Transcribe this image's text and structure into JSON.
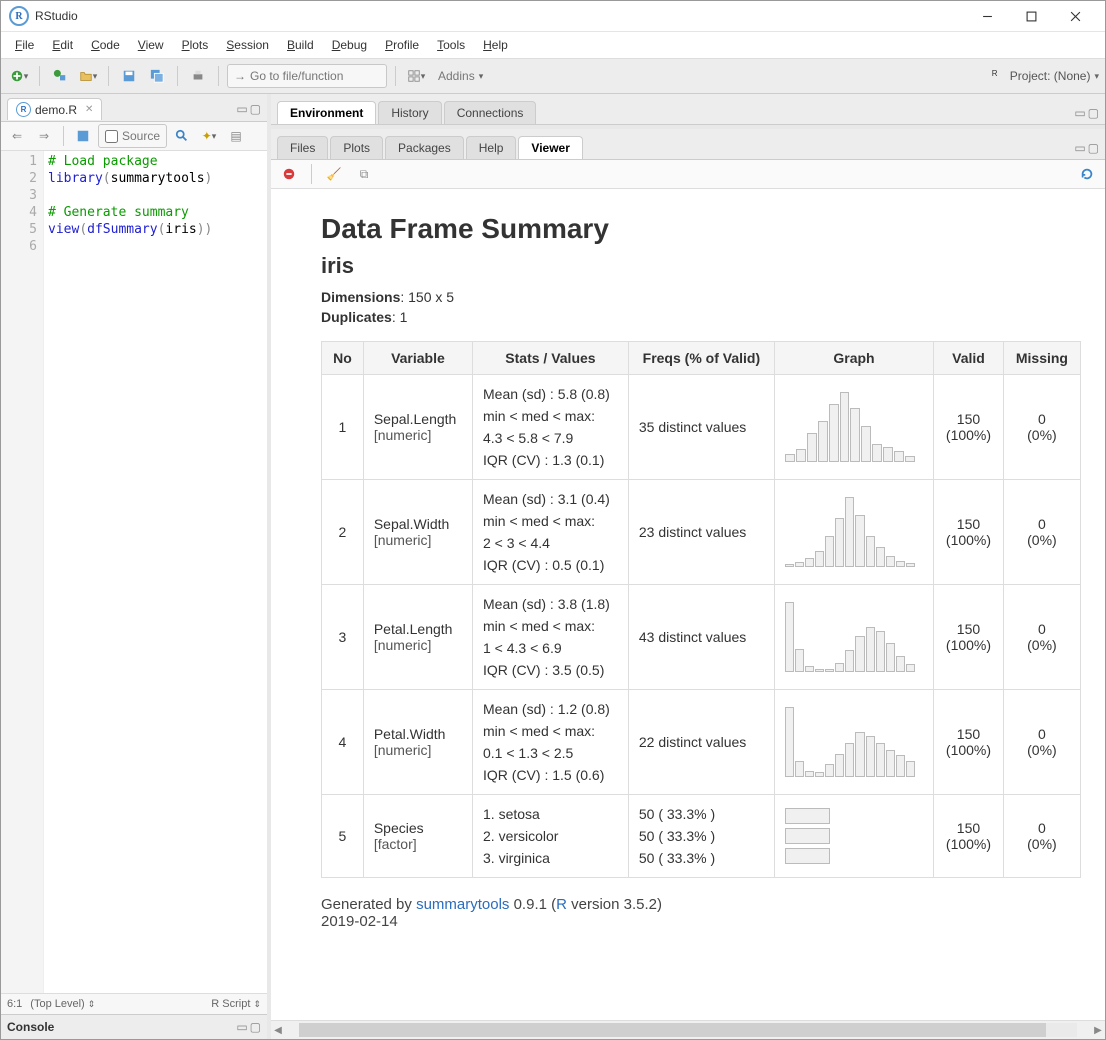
{
  "window": {
    "title": "RStudio",
    "project_label": "Project: (None)"
  },
  "menubar": [
    {
      "label": "File",
      "u": 0
    },
    {
      "label": "Edit",
      "u": 0
    },
    {
      "label": "Code",
      "u": 0
    },
    {
      "label": "View",
      "u": 0
    },
    {
      "label": "Plots",
      "u": 0
    },
    {
      "label": "Session",
      "u": 0
    },
    {
      "label": "Build",
      "u": 0
    },
    {
      "label": "Debug",
      "u": 0
    },
    {
      "label": "Profile",
      "u": 0
    },
    {
      "label": "Tools",
      "u": 0
    },
    {
      "label": "Help",
      "u": 0
    }
  ],
  "toolbar": {
    "goto_placeholder": "Go to file/function",
    "addins_label": "Addins"
  },
  "editor": {
    "filename": "demo.R",
    "source_btn": "Source",
    "gutter": [
      1,
      2,
      3,
      4,
      5,
      6
    ],
    "lines": [
      [
        {
          "t": "# Load package",
          "cls": "c-comment"
        }
      ],
      [
        {
          "t": "library",
          "cls": "c-func"
        },
        {
          "t": "(",
          "cls": "c-paren"
        },
        {
          "t": "summarytools",
          "cls": "c-ident"
        },
        {
          "t": ")",
          "cls": "c-paren"
        }
      ],
      [],
      [
        {
          "t": "# Generate summary",
          "cls": "c-comment"
        }
      ],
      [
        {
          "t": "view",
          "cls": "c-func"
        },
        {
          "t": "(",
          "cls": "c-paren"
        },
        {
          "t": "dfSummary",
          "cls": "c-func"
        },
        {
          "t": "(",
          "cls": "c-paren"
        },
        {
          "t": "iris",
          "cls": "c-ident"
        },
        {
          "t": "))",
          "cls": "c-paren"
        }
      ],
      []
    ],
    "status_pos": "6:1",
    "status_scope": "(Top Level)",
    "status_lang": "R Script"
  },
  "top_right_tabs": [
    "Environment",
    "History",
    "Connections"
  ],
  "bottom_right_tabs": [
    "Files",
    "Plots",
    "Packages",
    "Help",
    "Viewer"
  ],
  "console_label": "Console",
  "chart_data": {
    "type": "table",
    "title": "Data Frame Summary",
    "subtitle": "iris",
    "dimensions_label": "Dimensions",
    "dimensions": "150 x 5",
    "duplicates_label": "Duplicates",
    "duplicates": "1",
    "columns": [
      "No",
      "Variable",
      "Stats / Values",
      "Freqs (% of Valid)",
      "Graph",
      "Valid",
      "Missing"
    ],
    "rows": [
      {
        "no": 1,
        "variable": "Sepal.Length",
        "vartype": "[numeric]",
        "stats": [
          "Mean (sd) : 5.8 (0.8)",
          "min < med < max:",
          "4.3 < 5.8 < 7.9",
          "IQR (CV) : 1.3 (0.1)"
        ],
        "freqs": [
          "35 distinct values"
        ],
        "hist": [
          8,
          15,
          38,
          55,
          78,
          95,
          72,
          48,
          22,
          18,
          12,
          5
        ],
        "valid": [
          "150",
          "(100%)"
        ],
        "missing": [
          "0",
          "(0%)"
        ]
      },
      {
        "no": 2,
        "variable": "Sepal.Width",
        "vartype": "[numeric]",
        "stats": [
          "Mean (sd) : 3.1 (0.4)",
          "min < med < max:",
          "2 < 3 < 4.4",
          "IQR (CV) : 0.5 (0.1)"
        ],
        "freqs": [
          "23 distinct values"
        ],
        "hist": [
          2,
          4,
          10,
          20,
          40,
          65,
          95,
          70,
          40,
          25,
          12,
          6,
          3
        ],
        "valid": [
          "150",
          "(100%)"
        ],
        "missing": [
          "0",
          "(0%)"
        ]
      },
      {
        "no": 3,
        "variable": "Petal.Length",
        "vartype": "[numeric]",
        "stats": [
          "Mean (sd) : 3.8 (1.8)",
          "min < med < max:",
          "1 < 4.3 < 6.9",
          "IQR (CV) : 3.5 (0.5)"
        ],
        "freqs": [
          "43 distinct values"
        ],
        "hist": [
          95,
          30,
          5,
          2,
          2,
          10,
          28,
          48,
          60,
          55,
          38,
          20,
          8
        ],
        "valid": [
          "150",
          "(100%)"
        ],
        "missing": [
          "0",
          "(0%)"
        ]
      },
      {
        "no": 4,
        "variable": "Petal.Width",
        "vartype": "[numeric]",
        "stats": [
          "Mean (sd) : 1.2 (0.8)",
          "min < med < max:",
          "0.1 < 1.3 < 2.5",
          "IQR (CV) : 1.5 (0.6)"
        ],
        "freqs": [
          "22 distinct values"
        ],
        "hist": [
          95,
          20,
          5,
          4,
          15,
          30,
          45,
          60,
          55,
          45,
          35,
          28,
          20
        ],
        "valid": [
          "150",
          "(100%)"
        ],
        "missing": [
          "0",
          "(0%)"
        ]
      },
      {
        "no": 5,
        "variable": "Species",
        "vartype": "[factor]",
        "stats": [
          "1. setosa",
          "2. versicolor",
          "3. virginica"
        ],
        "freqs": [
          "50 ( 33.3% )",
          "50 ( 33.3% )",
          "50 ( 33.3% )"
        ],
        "proportions": [
          33.3,
          33.3,
          33.3
        ],
        "valid": [
          "150",
          "(100%)"
        ],
        "missing": [
          "0",
          "(0%)"
        ]
      }
    ],
    "footer_prefix": "Generated by ",
    "footer_link1": "summarytools",
    "footer_mid": " 0.9.1 (",
    "footer_link2": "R",
    "footer_suffix": " version 3.5.2)",
    "footer_date": "2019-02-14"
  }
}
